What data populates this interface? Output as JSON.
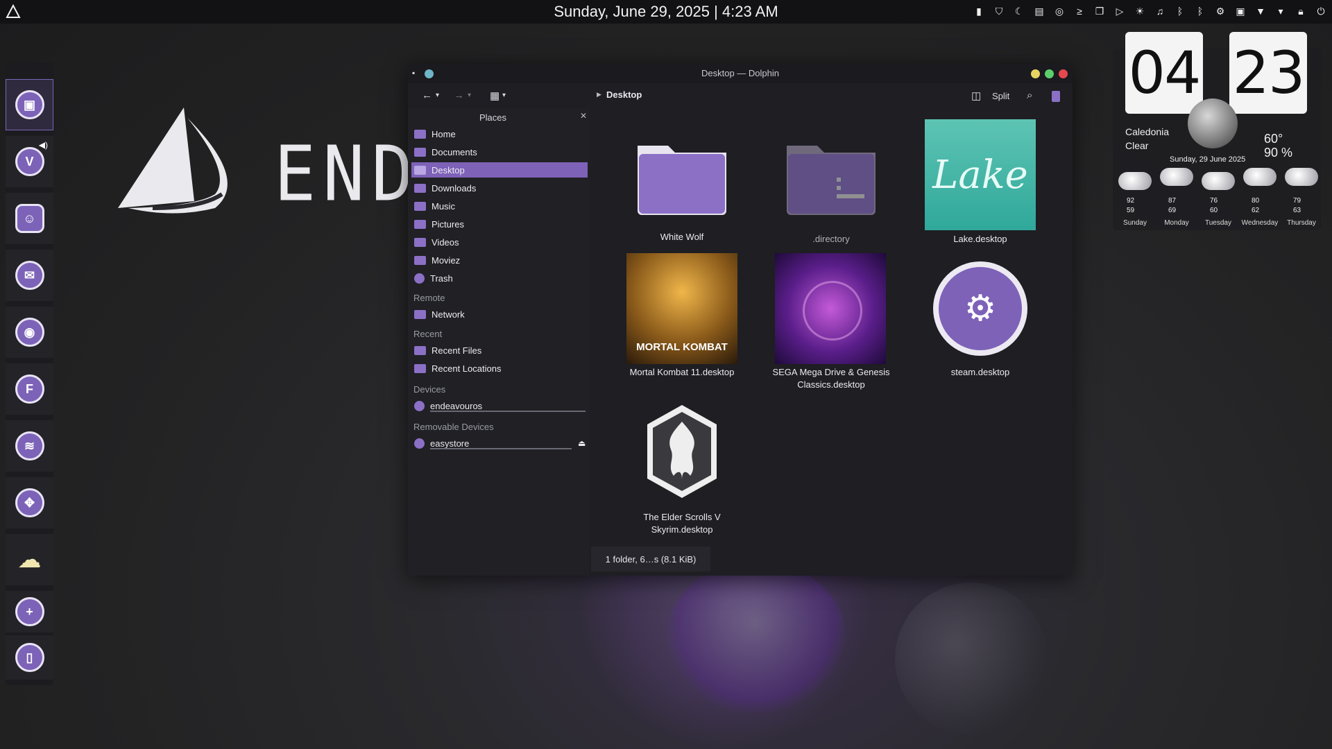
{
  "topbar": {
    "datetime": "Sunday, June 29, 2025 | 4:23 AM",
    "tray_icons": [
      "battery-icon",
      "shield-icon",
      "moon-icon",
      "clipboard-icon",
      "target-icon",
      "terminal-icon",
      "windows-icon",
      "play-icon",
      "brightness-icon",
      "volume-icon",
      "bluetooth-icon",
      "bluetooth-icon",
      "settings-icon",
      "display-icon",
      "wifi-icon",
      "chevron-down-icon",
      "lock-icon",
      "power-icon"
    ]
  },
  "dock": {
    "items": [
      {
        "name": "file-manager",
        "glyph": "▣"
      },
      {
        "name": "vivaldi",
        "glyph": "V"
      },
      {
        "name": "ghost-app",
        "glyph": "☺"
      },
      {
        "name": "mail",
        "glyph": "✉"
      },
      {
        "name": "disk",
        "glyph": "◉"
      },
      {
        "name": "f-app",
        "glyph": "F"
      },
      {
        "name": "spotify",
        "glyph": "≋"
      },
      {
        "name": "games",
        "glyph": "✥"
      },
      {
        "name": "weather",
        "glyph": "☁"
      },
      {
        "name": "add",
        "glyph": "+"
      },
      {
        "name": "trash",
        "glyph": "▯"
      }
    ]
  },
  "wallpaper": {
    "brand_text": "ENDEA"
  },
  "window": {
    "title": "Desktop — Dolphin",
    "breadcrumb": "Desktop",
    "split_label": "Split",
    "places_title": "Places",
    "places": [
      {
        "label": "Home"
      },
      {
        "label": "Documents"
      },
      {
        "label": "Desktop"
      },
      {
        "label": "Downloads"
      },
      {
        "label": "Music"
      },
      {
        "label": "Pictures"
      },
      {
        "label": "Videos"
      },
      {
        "label": "Moviez"
      },
      {
        "label": "Trash"
      }
    ],
    "sections": {
      "remote": "Remote",
      "recent": "Recent",
      "devices": "Devices",
      "removable": "Removable Devices"
    },
    "remote_items": [
      {
        "label": "Network"
      }
    ],
    "recent_items": [
      {
        "label": "Recent Files"
      },
      {
        "label": "Recent Locations"
      }
    ],
    "device_items": [
      {
        "label": "endeavouros"
      }
    ],
    "removable_items": [
      {
        "label": "easystore"
      }
    ],
    "files": [
      {
        "label": "White Wolf"
      },
      {
        "label": ".directory"
      },
      {
        "label": "Lake.desktop"
      },
      {
        "label": "Mortal Kombat 11.desktop"
      },
      {
        "label": "SEGA Mega Drive & Genesis Classics.desktop"
      },
      {
        "label": "steam.desktop"
      },
      {
        "label": "The Elder Scrolls V Skyrim.desktop"
      }
    ],
    "thumb_text": {
      "lake": "Lake",
      "mk": "MORTAL KOMBAT"
    },
    "status": "1 folder, 6…s (8.1 KiB)"
  },
  "clock_widget": {
    "hours": "04",
    "minutes": "23"
  },
  "weather_widget": {
    "location": "Caledonia",
    "condition": "Clear",
    "temp": "60°",
    "humidity": "90 %",
    "date": "Sunday, 29 June 2025",
    "forecast": [
      {
        "day": "Sunday",
        "high": "92",
        "low": "59"
      },
      {
        "day": "Monday",
        "high": "87",
        "low": "69"
      },
      {
        "day": "Tuesday",
        "high": "76",
        "low": "60"
      },
      {
        "day": "Wednesday",
        "high": "80",
        "low": "62"
      },
      {
        "day": "Thursday",
        "high": "79",
        "low": "63"
      }
    ]
  },
  "colors": {
    "accent": "#7e62b8",
    "folder": "#8b70c6"
  }
}
